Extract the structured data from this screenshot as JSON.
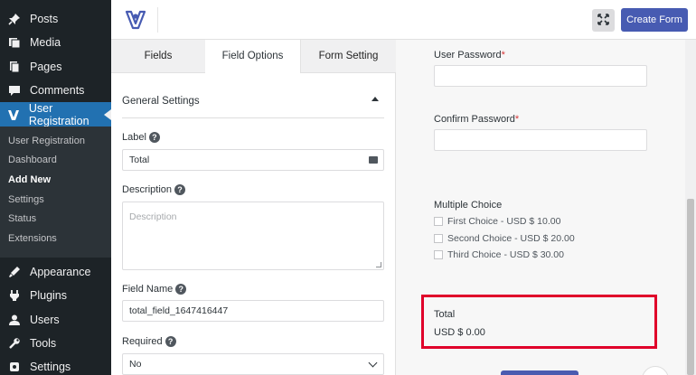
{
  "sidebar": {
    "items": [
      {
        "label": "Posts",
        "icon": "pushpin-icon"
      },
      {
        "label": "Media",
        "icon": "media-icon"
      },
      {
        "label": "Pages",
        "icon": "pages-icon"
      },
      {
        "label": "Comments",
        "icon": "comments-icon"
      },
      {
        "label": "User Registration",
        "icon": "user-registration-icon"
      },
      {
        "label": "Appearance",
        "icon": "appearance-icon"
      },
      {
        "label": "Plugins",
        "icon": "plugins-icon"
      },
      {
        "label": "Users",
        "icon": "users-icon"
      },
      {
        "label": "Tools",
        "icon": "tools-icon"
      },
      {
        "label": "Settings",
        "icon": "settings-icon"
      }
    ],
    "submenu": [
      "User Registration",
      "Dashboard",
      "Add New",
      "Settings",
      "Status",
      "Extensions"
    ]
  },
  "topbar": {
    "create_form_label": "Create Form",
    "accent": "#475bb2"
  },
  "tabs": [
    "Fields",
    "Field Options",
    "Form Setting"
  ],
  "options": {
    "section_title": "General Settings",
    "label_label": "Label",
    "label_value": "Total",
    "description_label": "Description",
    "description_placeholder": "Description",
    "field_name_label": "Field Name",
    "field_name_value": "total_field_1647416447",
    "required_label": "Required",
    "required_value": "No"
  },
  "preview": {
    "user_password_label": "User Password",
    "confirm_password_label": "Confirm Password",
    "required_mark": "*",
    "multiple_choice_label": "Multiple Choice",
    "choices": [
      "First Choice - USD $ 10.00",
      "Second Choice - USD $ 20.00",
      "Third Choice - USD $ 30.00"
    ],
    "total_label": "Total",
    "total_value": "USD $ 0.00",
    "highlight_color": "#e0002a"
  }
}
